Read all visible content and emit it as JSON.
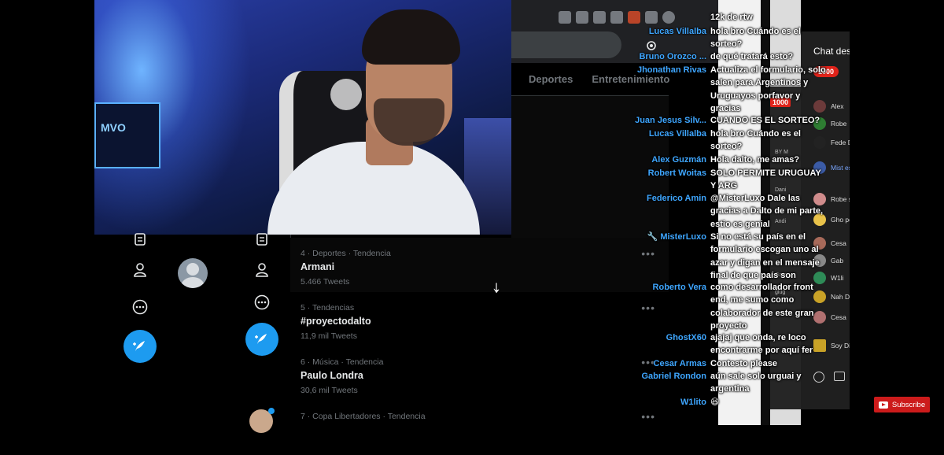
{
  "browser": {
    "icons": [
      "install-icon",
      "zoom-icon",
      "share-icon",
      "star-icon",
      "brave-icon",
      "extensions-icon",
      "profile-icon"
    ]
  },
  "twitter": {
    "tabs": [
      "Deportes",
      "Entretenimiento"
    ],
    "trends": [
      {
        "meta": "4 · Deportes · Tendencia",
        "name": "Armani",
        "count": "5.466 Tweets"
      },
      {
        "meta": "5 · Tendencias",
        "name": "#proyectodalto",
        "count": "11,9 mil Tweets"
      },
      {
        "meta": "6 · Música · Tendencia",
        "name": "Paulo Londra",
        "count": "30,6 mil Tweets"
      },
      {
        "meta": "7 · Copa Libertadores · Tendencia",
        "name": "",
        "count": ""
      }
    ],
    "more_label": "•••",
    "accent": "#1d9bf0"
  },
  "webcam": {
    "monitor_label": "MVO"
  },
  "chat": {
    "messages": [
      {
        "author": "",
        "text": "12k de rtw"
      },
      {
        "author": "Lucas Villalba",
        "text": "hola bro Cuándo es el sorteo?"
      },
      {
        "author": "Bruno Orozco ...",
        "text": "de qué tratará esto?"
      },
      {
        "author": "Jhonathan Rivas",
        "text": "Actualiza el formulario, solo salen para Argentinos y Uruguayos porfavor y gracias"
      },
      {
        "author": "Juan Jesus Silv...",
        "text": "CUANDO ES EL SORTEO?"
      },
      {
        "author": "Lucas Villalba",
        "text": "hola bro Cuándo es el sorteo?"
      },
      {
        "author": "Alex Guzmán",
        "text": "Hola dalto, me amas?"
      },
      {
        "author": "Robert Woitas",
        "text": "SOLO PERMITE URUGUAY Y ARG"
      },
      {
        "author": "Federico Amin",
        "text": "@MisterLuxo Dale las gracias a Dalto de mi parte, estio es genial"
      },
      {
        "author": "MisterLuxo",
        "text": "Si no está su país en el formulario escogan uno al azar y digan en el mensaje final de que país son"
      },
      {
        "author": "Roberto Vera",
        "text": "como desarrollador front end, me sumo como colaborador de este gran proyecto"
      },
      {
        "author": "GhostX60",
        "text": "ajajaj que onda, re loco encontrarme por aquí fer"
      },
      {
        "author": "Cesar Armas",
        "text": "Contesto please"
      },
      {
        "author": "Gabriel Rondon",
        "text": "aún sale solo urguai y argentina"
      },
      {
        "author": "W1lito",
        "text": "😆"
      }
    ]
  },
  "side_chat": {
    "title": "Chat dest",
    "badge": "1000",
    "rows": [
      "",
      "Alex",
      "Robe",
      "Fede DAKT",
      "Mist esco que",
      "Robe sum",
      "Gho por a",
      "Cesa",
      "Gab",
      "W1li",
      "Nah DAL",
      "Cesa",
      "Soy Di al"
    ],
    "mini": [
      "BY M",
      "Dani",
      "Andi",
      "Gato",
      "glug"
    ]
  },
  "youtube": {
    "subscribe_label": "Subscribe"
  }
}
